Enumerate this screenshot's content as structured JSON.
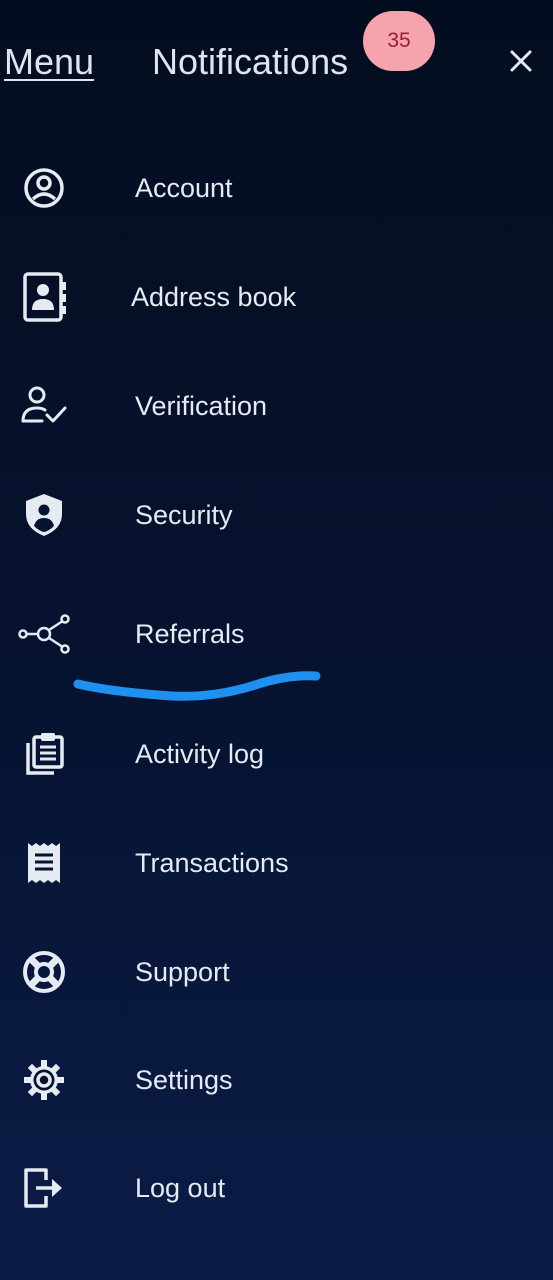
{
  "header": {
    "menu_tab": "Menu",
    "notifications_tab": "Notifications",
    "notifications_count": "35",
    "close_label": "×"
  },
  "menu": {
    "items": [
      {
        "label": "Account",
        "icon": "account-circle-icon"
      },
      {
        "label": "Address book",
        "icon": "address-book-icon"
      },
      {
        "label": "Verification",
        "icon": "user-check-icon"
      },
      {
        "label": "Security",
        "icon": "shield-user-icon"
      },
      {
        "label": "Referrals",
        "icon": "network-icon"
      },
      {
        "label": "Activity log",
        "icon": "clipboard-list-icon"
      },
      {
        "label": "Transactions",
        "icon": "receipt-icon"
      },
      {
        "label": "Support",
        "icon": "lifebuoy-icon"
      },
      {
        "label": "Settings",
        "icon": "gear-icon"
      },
      {
        "label": "Log out",
        "icon": "logout-icon"
      }
    ]
  },
  "colors": {
    "background_top": "#040d1f",
    "background_bottom": "#0b1c47",
    "text": "#e6ebf2",
    "badge_bg": "#f6a3ad",
    "badge_text": "#9b1f2f",
    "annotation_stroke": "#1e90f0"
  }
}
